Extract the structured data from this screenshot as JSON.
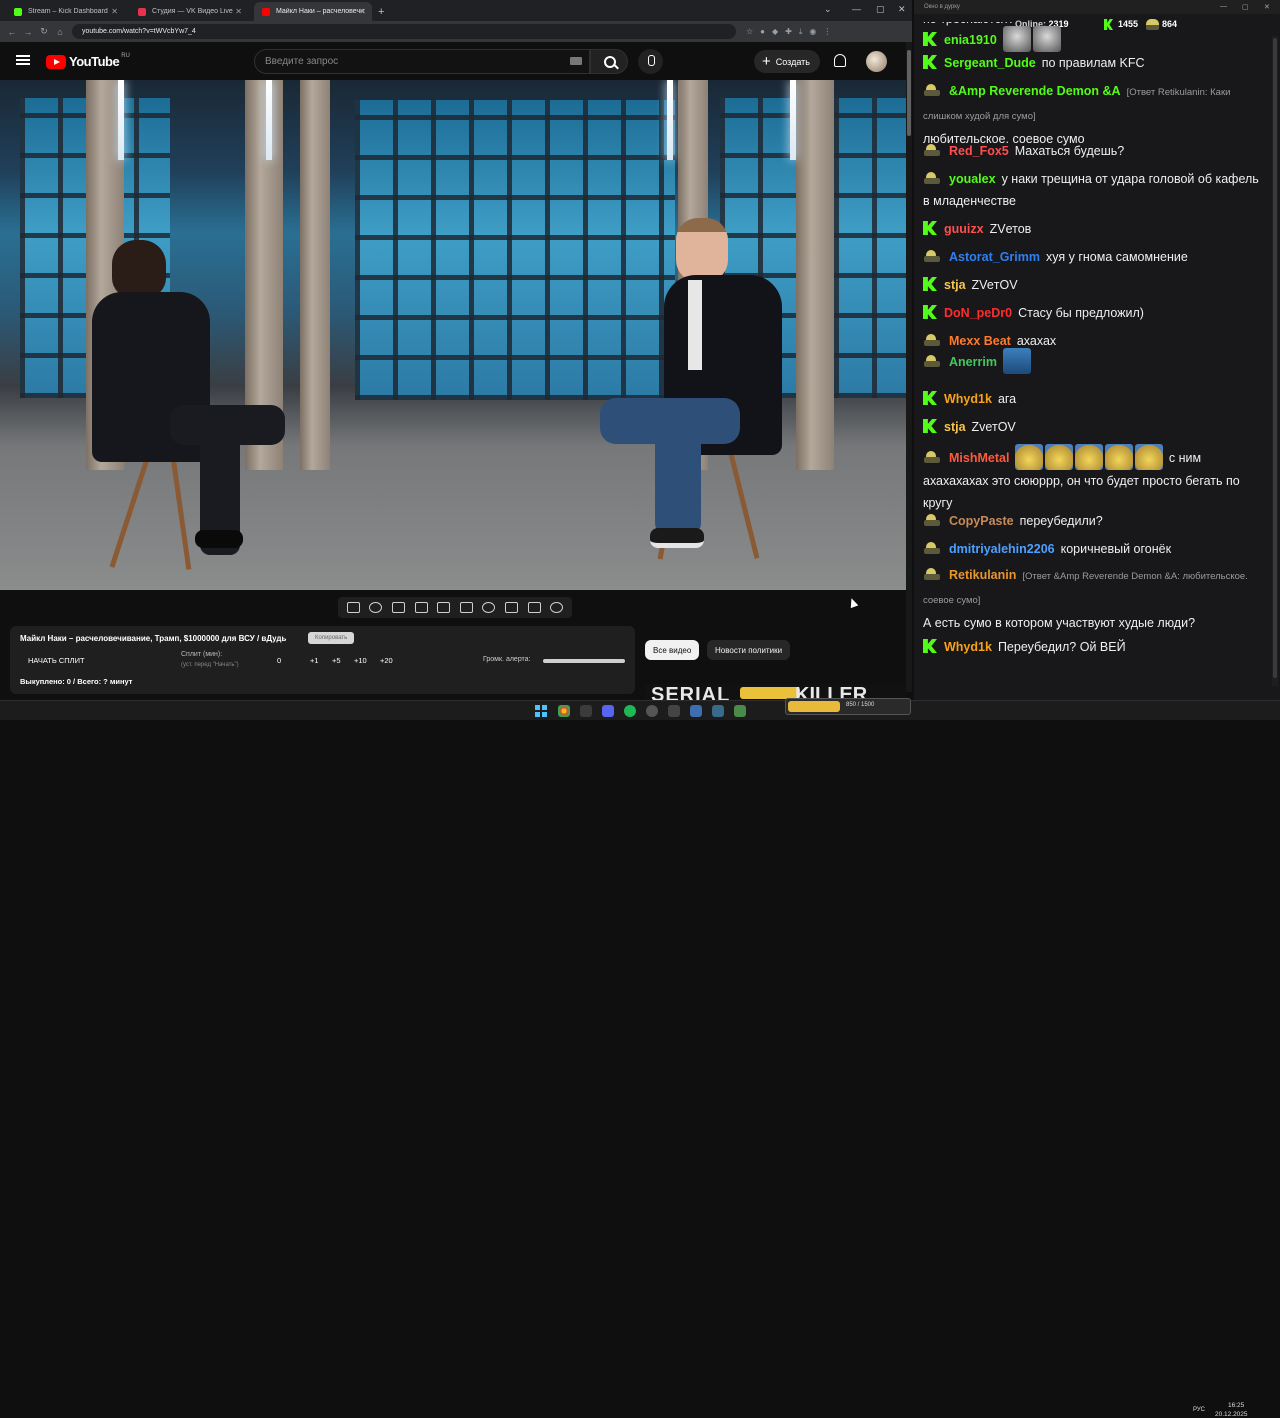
{
  "browser": {
    "tabs": [
      {
        "title": "Stream – Kick Dashboard",
        "favicon_color": "#53fc18",
        "active": false
      },
      {
        "title": "Студия — VK Видео Live",
        "favicon_color": "#e6334d",
        "active": false
      },
      {
        "title": "Майкл Наки – расчеловечи…",
        "favicon_color": "#ff0000",
        "active": true
      }
    ],
    "url": "youtube.com/watch?v=tWVcbYw7_4"
  },
  "youtube": {
    "logo_text": "YouTube",
    "logo_region": "RU",
    "search_placeholder": "Введите запрос",
    "create_label": "Создать"
  },
  "extension": {
    "title": "Майкл Наки – расчеловечивание, Трамп, $1000000 для ВСУ / вДудь",
    "copy_label": "Копировать",
    "start_split_label": "НАЧАТЬ СПЛИТ",
    "split_label": "Сплит (мин):",
    "split_sub": "(уст. перед \"Начать\")",
    "split_values": [
      "0",
      "+1",
      "+5",
      "+10",
      "+20"
    ],
    "volume_label": "Громк. алерта:",
    "bought_label": "Выкуплено: 0 / Всего: ? минут"
  },
  "chips": {
    "all": "Все видео",
    "news": "Новости политики"
  },
  "thumbnail": {
    "text_left": "SERIAL",
    "text_right": "KILLER"
  },
  "chat": {
    "window_title": "Окно в дурку",
    "online_label": "Online:",
    "online_count": "2319",
    "kick_count": "1455",
    "vk_count": "864",
    "truncated_top": "по треснаются?",
    "messages": [
      {
        "platform": "kick",
        "nick": "enia1910",
        "color": "#53fc18",
        "text": "",
        "emotes": [
          "cat",
          "cat"
        ]
      },
      {
        "platform": "kick",
        "nick": "Sergeant_Dude",
        "color": "#53fc18",
        "text": "по правилам KFC"
      },
      {
        "platform": "vk",
        "nick": "&Amp Reverende Demon &A",
        "color": "#53fc18",
        "reply": "[Ответ Retikulanin: Каки слишком худой для сумо]",
        "text": "любительское. соевое сумо"
      },
      {
        "platform": "vk",
        "nick": "Red_Fox5",
        "color": "#ff4f4f",
        "text": "Махаться будешь?"
      },
      {
        "platform": "vk",
        "nick": "youalex",
        "color": "#53fc18",
        "text": "у наки трещина от удара головой об кафель в младенчестве"
      },
      {
        "platform": "kick",
        "nick": "guuizx",
        "color": "#ff4f4f",
        "text": "ZVетов"
      },
      {
        "platform": "vk",
        "nick": "Astorat_Grimm",
        "color": "#2f7ff1",
        "text": "хуя у гнома самомнение"
      },
      {
        "platform": "kick",
        "nick": "stja",
        "color": "#f7c548",
        "text": "ZVeтOV"
      },
      {
        "platform": "kick",
        "nick": "DoN_peDr0",
        "color": "#ff2d2d",
        "text": "Стасу бы предложил)"
      },
      {
        "platform": "vk",
        "nick": "Mexx Beat",
        "color": "#ff7a2e",
        "text": "ахахах"
      },
      {
        "platform": "vk",
        "nick": "Anerrim",
        "color": "#3fca5a",
        "text": "",
        "emotes": [
          "blue"
        ]
      },
      {
        "platform": "kick",
        "nick": "Whyd1k",
        "color": "#f7a21b",
        "text": "ага"
      },
      {
        "platform": "kick",
        "nick": "stja",
        "color": "#f7c548",
        "text": "ZvетOV"
      },
      {
        "platform": "vk",
        "nick": "MishMetal",
        "color": "#ff5a3c",
        "text": "с ним ахахахахах это сююррр, он что будет просто бегать по кругу",
        "emotes": [
          "smile",
          "smile",
          "smile",
          "smile",
          "smile"
        ]
      },
      {
        "platform": "vk",
        "nick": "CopyPaste",
        "color": "#c98a57",
        "text": "переубедили?"
      },
      {
        "platform": "vk",
        "nick": "dmitriyalehin2206",
        "color": "#4ea0ff",
        "text": "коричневый огонёк"
      },
      {
        "platform": "vk",
        "nick": "Retikulanin",
        "color": "#e8952d",
        "reply": "[Ответ &Amp Reverende Demon &A: любительское. соевое сумо]",
        "text": "А есть сумо в котором участвуют худые люди?"
      },
      {
        "platform": "kick",
        "nick": "Whyd1k",
        "color": "#f7a21b",
        "text": "Переубедил? Ой ВЕЙ"
      }
    ]
  },
  "taskbar": {
    "widget_text": "850 / 1500",
    "lang": "РУС",
    "time": "16:25",
    "date": "20.12.2025"
  },
  "colors": {
    "kick": "#53fc18",
    "youtube_red": "#ff0000",
    "chat_bg": "#18181b"
  }
}
